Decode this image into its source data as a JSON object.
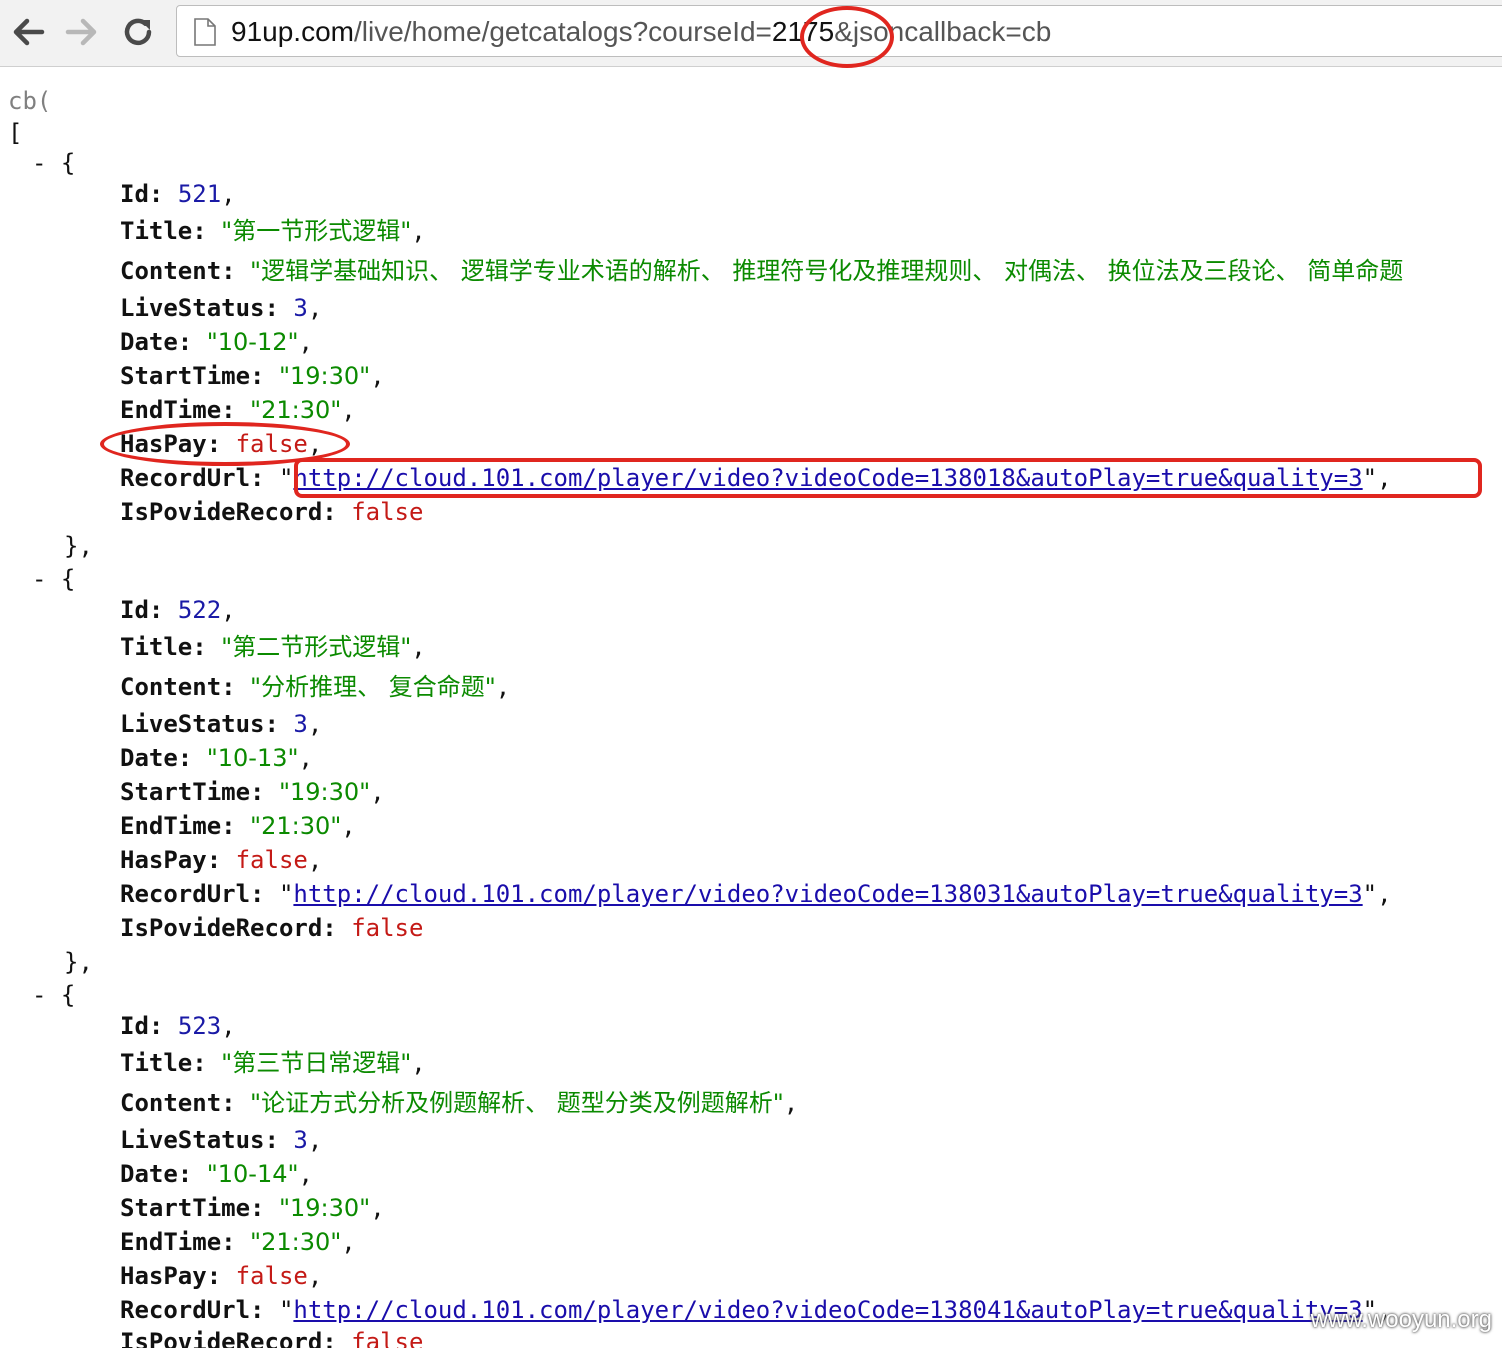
{
  "address_bar": {
    "host": "91up.com",
    "path_before_id": "/live/home/getcatalogs?courseId=",
    "course_id": "2175",
    "path_after_id": "&jsoncallback=cb"
  },
  "response": {
    "callback_open": "cb(",
    "array_open": "[",
    "collapse_toggle": "- {",
    "object_close": "},",
    "keys": {
      "id": "Id:",
      "title": "Title:",
      "content": "Content:",
      "live_status": "LiveStatus:",
      "date": "Date:",
      "start_time": "StartTime:",
      "end_time": "EndTime:",
      "has_pay": "HasPay:",
      "record_url": "RecordUrl:",
      "is_povide_record": "IsPovideRecord:"
    },
    "items": [
      {
        "id": "521",
        "title": "\"第一节形式逻辑\"",
        "content": "\"逻辑学基础知识、 逻辑学专业术语的解析、 推理符号化及推理规则、 对偶法、 换位法及三段论、 简单命题",
        "live_status": "3",
        "date": "\"10-12\"",
        "start_time": "\"19:30\"",
        "end_time": "\"21:30\"",
        "has_pay": "false",
        "record_url": "http://cloud.101.com/player/video?videoCode=138018&autoPlay=true&quality=3",
        "is_povide_record": "false"
      },
      {
        "id": "522",
        "title": "\"第二节形式逻辑\"",
        "content": "\"分析推理、 复合命题\"",
        "live_status": "3",
        "date": "\"10-13\"",
        "start_time": "\"19:30\"",
        "end_time": "\"21:30\"",
        "has_pay": "false",
        "record_url": "http://cloud.101.com/player/video?videoCode=138031&autoPlay=true&quality=3",
        "is_povide_record": "false"
      },
      {
        "id": "523",
        "title": "\"第三节日常逻辑\"",
        "content": "\"论证方式分析及例题解析、 题型分类及例题解析\"",
        "live_status": "3",
        "date": "\"10-14\"",
        "start_time": "\"19:30\"",
        "end_time": "\"21:30\"",
        "has_pay": "false",
        "record_url": "http://cloud.101.com/player/video?videoCode=138041&autoPlay=true&quality=3",
        "is_povide_record": "false"
      }
    ]
  },
  "watermark": "www.wooyun.org",
  "colors": {
    "annotation": "#e0261f",
    "string": "#0b8a00",
    "number": "#1a1aa6",
    "boolean": "#c41a16",
    "link": "#1a0dab"
  }
}
